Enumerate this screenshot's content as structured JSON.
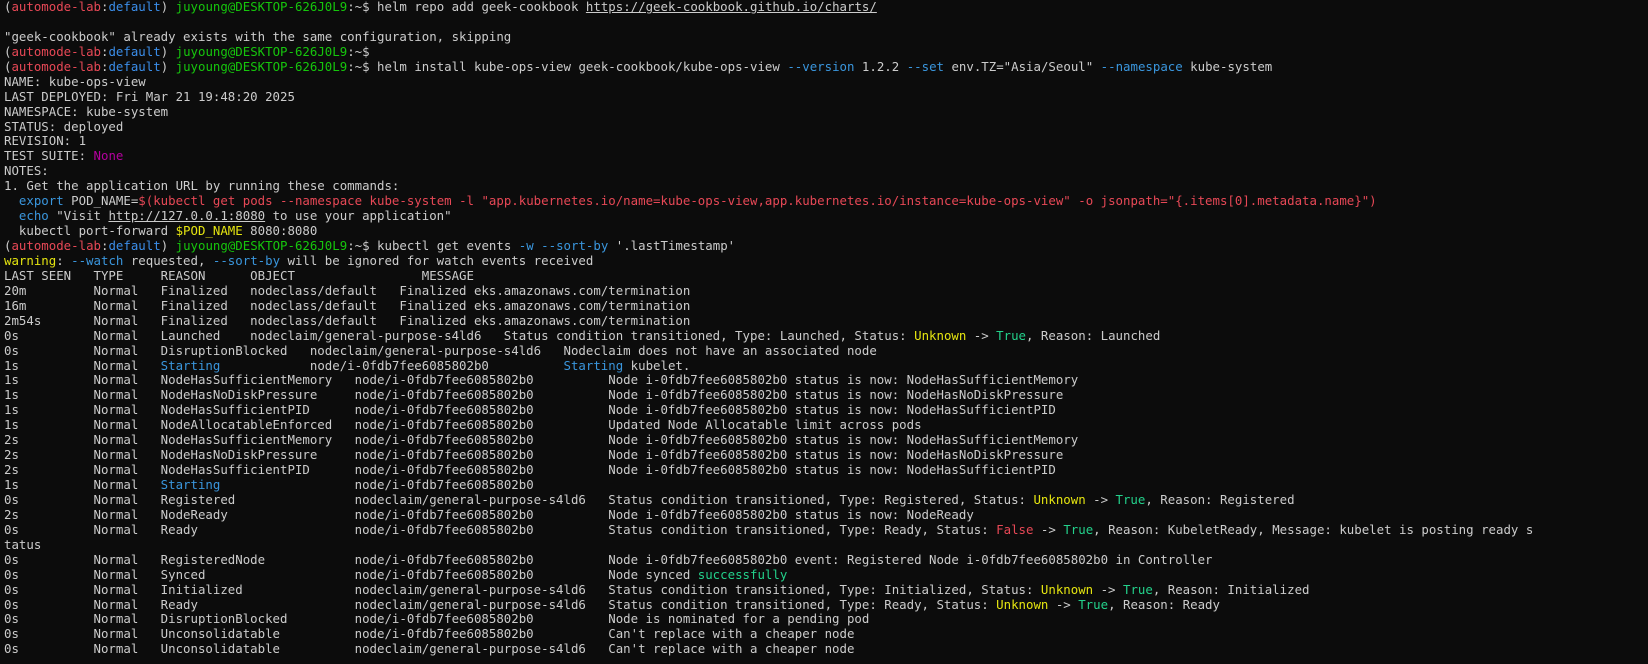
{
  "colors": {
    "background": "#0c0c0c",
    "text": "#cccccc",
    "prompt_red": "#e74856",
    "prompt_blue": "#3b8eea",
    "prompt_green": "#16c60c",
    "flag_cyan": "#3a96dd",
    "string_red": "#e74856",
    "bright_green": "#23d18b",
    "yellow": "#e5e510",
    "magenta": "#b4009e",
    "link_text": "#cccccc"
  },
  "terminal": {
    "lines": [
      [
        [
          "(",
          "text"
        ],
        [
          "automode-lab",
          "prompt_red"
        ],
        [
          ":",
          "text"
        ],
        [
          "default",
          "prompt_blue"
        ],
        [
          ") ",
          "text"
        ],
        [
          "juyoung@DESKTOP-626J0L9",
          "prompt_green"
        ],
        [
          ":~$ helm repo add geek-cookbook ",
          "text"
        ],
        [
          "https://geek-cookbook.github.io/charts/",
          "link_text",
          "u"
        ]
      ],
      [
        [
          "",
          "text"
        ]
      ],
      [
        [
          "\"geek-cookbook\" already exists with the same configuration, skipping",
          "text"
        ]
      ],
      [
        [
          "(",
          "text"
        ],
        [
          "automode-lab",
          "prompt_red"
        ],
        [
          ":",
          "text"
        ],
        [
          "default",
          "prompt_blue"
        ],
        [
          ") ",
          "text"
        ],
        [
          "juyoung@DESKTOP-626J0L9",
          "prompt_green"
        ],
        [
          ":~$",
          "text"
        ]
      ],
      [
        [
          "(",
          "text"
        ],
        [
          "automode-lab",
          "prompt_red"
        ],
        [
          ":",
          "text"
        ],
        [
          "default",
          "prompt_blue"
        ],
        [
          ") ",
          "text"
        ],
        [
          "juyoung@DESKTOP-626J0L9",
          "prompt_green"
        ],
        [
          ":~$ helm install kube-ops-view geek-cookbook/kube-ops-view ",
          "text"
        ],
        [
          "--version",
          "flag_cyan"
        ],
        [
          " 1.2.2 ",
          "text"
        ],
        [
          "--set",
          "flag_cyan"
        ],
        [
          " env.TZ=\"Asia/Seoul\" ",
          "text"
        ],
        [
          "--namespace",
          "flag_cyan"
        ],
        [
          " kube-system",
          "text"
        ]
      ],
      [
        [
          "NAME: kube-ops-view",
          "text"
        ]
      ],
      [
        [
          "LAST DEPLOYED: Fri Mar 21 19:48:20 2025",
          "text"
        ]
      ],
      [
        [
          "NAMESPACE: kube-system",
          "text"
        ]
      ],
      [
        [
          "STATUS: deployed",
          "text"
        ]
      ],
      [
        [
          "REVISION: 1",
          "text"
        ]
      ],
      [
        [
          "TEST SUITE: ",
          "text"
        ],
        [
          "None",
          "magenta"
        ]
      ],
      [
        [
          "NOTES:",
          "text"
        ]
      ],
      [
        [
          "1. Get the application URL by running these commands:",
          "text"
        ]
      ],
      [
        [
          "  ",
          "text"
        ],
        [
          "export",
          "flag_cyan"
        ],
        [
          " POD_NAME=",
          "text"
        ],
        [
          "$(kubectl get pods --namespace kube-system -l \"app.kubernetes.io/name=kube-ops-view,app.kubernetes.io/instance=kube-ops-view\" -o jsonpath=\"{.items[0].metadata.name}\")",
          "string_red"
        ]
      ],
      [
        [
          "  ",
          "text"
        ],
        [
          "echo",
          "flag_cyan"
        ],
        [
          " \"Visit ",
          "text"
        ],
        [
          "http://127.0.0.1:8080",
          "link_text",
          "u"
        ],
        [
          " to use your application\"",
          "text"
        ]
      ],
      [
        [
          "  kubectl port-forward ",
          "text"
        ],
        [
          "$POD_NAME",
          "yellow"
        ],
        [
          " 8080:8080",
          "text"
        ]
      ],
      [
        [
          "(",
          "text"
        ],
        [
          "automode-lab",
          "prompt_red"
        ],
        [
          ":",
          "text"
        ],
        [
          "default",
          "prompt_blue"
        ],
        [
          ") ",
          "text"
        ],
        [
          "juyoung@DESKTOP-626J0L9",
          "prompt_green"
        ],
        [
          ":~$ kubectl get events ",
          "text"
        ],
        [
          "-w",
          "flag_cyan"
        ],
        [
          " ",
          "text"
        ],
        [
          "--sort-by",
          "flag_cyan"
        ],
        [
          " '.lastTimestamp'",
          "text"
        ]
      ],
      [
        [
          "warning",
          "yellow"
        ],
        [
          ": ",
          "text"
        ],
        [
          "--watch",
          "flag_cyan"
        ],
        [
          " requested, ",
          "text"
        ],
        [
          "--sort-by",
          "flag_cyan"
        ],
        [
          " will be ignored for watch events received",
          "text"
        ]
      ],
      [
        [
          "LAST SEEN   TYPE     REASON      OBJECT                 MESSAGE",
          "text"
        ]
      ],
      [
        [
          "20m         Normal   Finalized   nodeclass/default   Finalized eks.amazonaws.com/termination",
          "text"
        ]
      ],
      [
        [
          "16m         Normal   Finalized   nodeclass/default   Finalized eks.amazonaws.com/termination",
          "text"
        ]
      ],
      [
        [
          "2m54s       Normal   Finalized   nodeclass/default   Finalized eks.amazonaws.com/termination",
          "text"
        ]
      ],
      [
        [
          "0s          Normal   Launched    nodeclaim/general-purpose-s4ld6   Status condition transitioned, Type: Launched, Status: ",
          "text"
        ],
        [
          "Unknown",
          "yellow"
        ],
        [
          " -> ",
          "text"
        ],
        [
          "True",
          "bright_green"
        ],
        [
          ", Reason: Launched",
          "text"
        ]
      ],
      [
        [
          "0s          Normal   DisruptionBlocked   nodeclaim/general-purpose-s4ld6   Nodeclaim does not have an associated node",
          "text"
        ]
      ],
      [
        [
          "1s          Normal   ",
          "text"
        ],
        [
          "Starting",
          "flag_cyan"
        ],
        [
          "            node/i-0fdb7fee6085802b0          ",
          "text"
        ],
        [
          "Starting",
          "flag_cyan"
        ],
        [
          " kubelet.",
          "text"
        ]
      ],
      [
        [
          "1s          Normal   NodeHasSufficientMemory   node/i-0fdb7fee6085802b0          Node i-0fdb7fee6085802b0 status is now: NodeHasSufficientMemory",
          "text"
        ]
      ],
      [
        [
          "1s          Normal   NodeHasNoDiskPressure     node/i-0fdb7fee6085802b0          Node i-0fdb7fee6085802b0 status is now: NodeHasNoDiskPressure",
          "text"
        ]
      ],
      [
        [
          "1s          Normal   NodeHasSufficientPID      node/i-0fdb7fee6085802b0          Node i-0fdb7fee6085802b0 status is now: NodeHasSufficientPID",
          "text"
        ]
      ],
      [
        [
          "1s          Normal   NodeAllocatableEnforced   node/i-0fdb7fee6085802b0          Updated Node Allocatable limit across pods",
          "text"
        ]
      ],
      [
        [
          "2s          Normal   NodeHasSufficientMemory   node/i-0fdb7fee6085802b0          Node i-0fdb7fee6085802b0 status is now: NodeHasSufficientMemory",
          "text"
        ]
      ],
      [
        [
          "2s          Normal   NodeHasNoDiskPressure     node/i-0fdb7fee6085802b0          Node i-0fdb7fee6085802b0 status is now: NodeHasNoDiskPressure",
          "text"
        ]
      ],
      [
        [
          "2s          Normal   NodeHasSufficientPID      node/i-0fdb7fee6085802b0          Node i-0fdb7fee6085802b0 status is now: NodeHasSufficientPID",
          "text"
        ]
      ],
      [
        [
          "1s          Normal   ",
          "text"
        ],
        [
          "Starting",
          "flag_cyan"
        ],
        [
          "                  node/i-0fdb7fee6085802b0",
          "text"
        ]
      ],
      [
        [
          "0s          Normal   Registered                nodeclaim/general-purpose-s4ld6   Status condition transitioned, Type: Registered, Status: ",
          "text"
        ],
        [
          "Unknown",
          "yellow"
        ],
        [
          " -> ",
          "text"
        ],
        [
          "True",
          "bright_green"
        ],
        [
          ", Reason: Registered",
          "text"
        ]
      ],
      [
        [
          "2s          Normal   NodeReady                 node/i-0fdb7fee6085802b0          Node i-0fdb7fee6085802b0 status is now: NodeReady",
          "text"
        ]
      ],
      [
        [
          "0s          Normal   Ready                     node/i-0fdb7fee6085802b0          Status condition transitioned, Type: Ready, Status: ",
          "text"
        ],
        [
          "False",
          "string_red"
        ],
        [
          " -> ",
          "text"
        ],
        [
          "True",
          "bright_green"
        ],
        [
          ", Reason: KubeletReady, Message: kubelet is posting ready s",
          "text"
        ]
      ],
      [
        [
          "tatus",
          "text"
        ]
      ],
      [
        [
          "0s          Normal   RegisteredNode            node/i-0fdb7fee6085802b0          Node i-0fdb7fee6085802b0 event: Registered Node i-0fdb7fee6085802b0 in Controller",
          "text"
        ]
      ],
      [
        [
          "0s          Normal   Synced                    node/i-0fdb7fee6085802b0          Node synced ",
          "text"
        ],
        [
          "successfully",
          "bright_green"
        ]
      ],
      [
        [
          "0s          Normal   Initialized               nodeclaim/general-purpose-s4ld6   Status condition transitioned, Type: Initialized, Status: ",
          "text"
        ],
        [
          "Unknown",
          "yellow"
        ],
        [
          " -> ",
          "text"
        ],
        [
          "True",
          "bright_green"
        ],
        [
          ", Reason: Initialized",
          "text"
        ]
      ],
      [
        [
          "0s          Normal   Ready                     nodeclaim/general-purpose-s4ld6   Status condition transitioned, Type: Ready, Status: ",
          "text"
        ],
        [
          "Unknown",
          "yellow"
        ],
        [
          " -> ",
          "text"
        ],
        [
          "True",
          "bright_green"
        ],
        [
          ", Reason: Ready",
          "text"
        ]
      ],
      [
        [
          "0s          Normal   DisruptionBlocked         node/i-0fdb7fee6085802b0          Node is nominated for a pending pod",
          "text"
        ]
      ],
      [
        [
          "0s          Normal   Unconsolidatable          node/i-0fdb7fee6085802b0          Can't replace with a cheaper node",
          "text"
        ]
      ],
      [
        [
          "0s          Normal   Unconsolidatable          nodeclaim/general-purpose-s4ld6   Can't replace with a cheaper node",
          "text"
        ]
      ]
    ]
  }
}
